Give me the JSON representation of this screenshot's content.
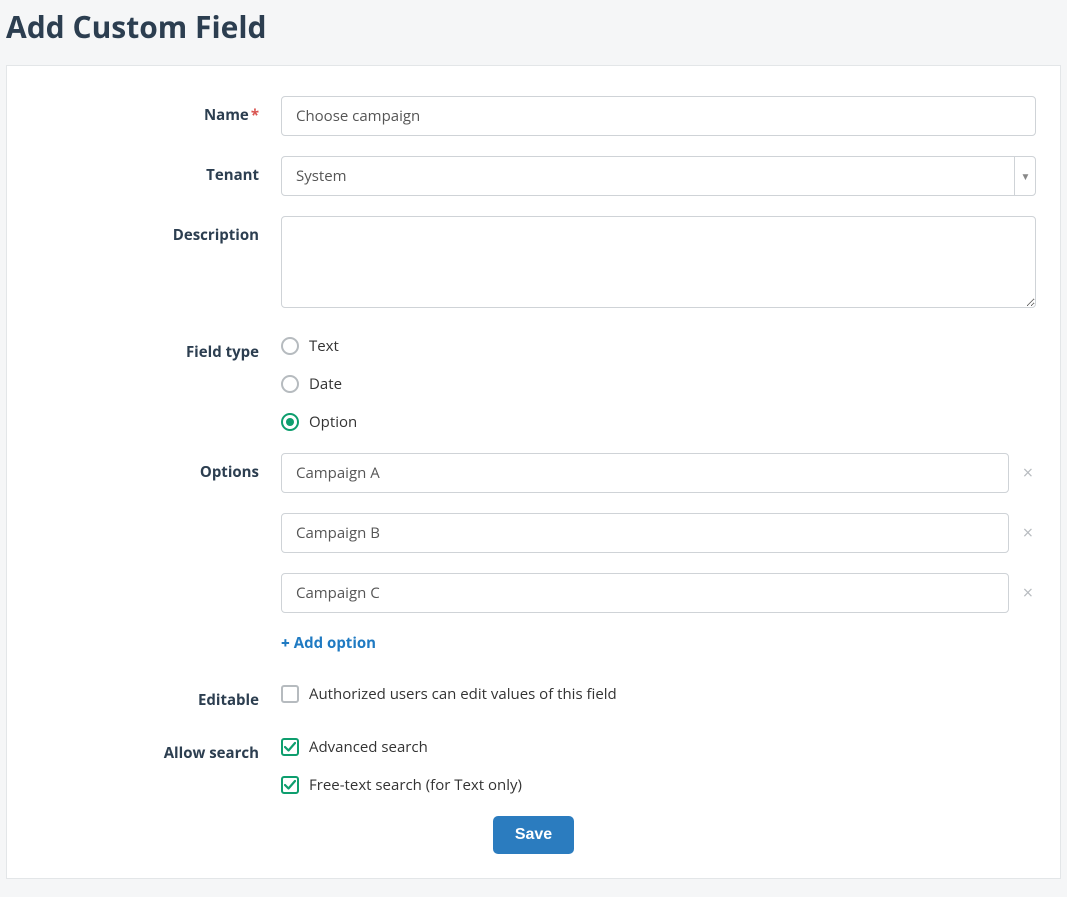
{
  "page": {
    "title": "Add Custom Field"
  },
  "labels": {
    "name": "Name",
    "tenant": "Tenant",
    "description": "Description",
    "field_type": "Field type",
    "options": "Options",
    "editable": "Editable",
    "allow_search": "Allow search"
  },
  "fields": {
    "name_value": "Choose campaign",
    "tenant_value": "System",
    "description_value": ""
  },
  "field_type": {
    "text": "Text",
    "date": "Date",
    "option": "Option",
    "selected": "option"
  },
  "options": [
    "Campaign A",
    "Campaign B",
    "Campaign C"
  ],
  "add_option_label": "Add option",
  "editable_check": {
    "label": "Authorized users can edit values of this field",
    "checked": false
  },
  "allow_search": {
    "advanced": {
      "label": "Advanced search",
      "checked": true
    },
    "freetext": {
      "label": "Free-text search (for Text only)",
      "checked": true
    }
  },
  "buttons": {
    "save": "Save"
  }
}
